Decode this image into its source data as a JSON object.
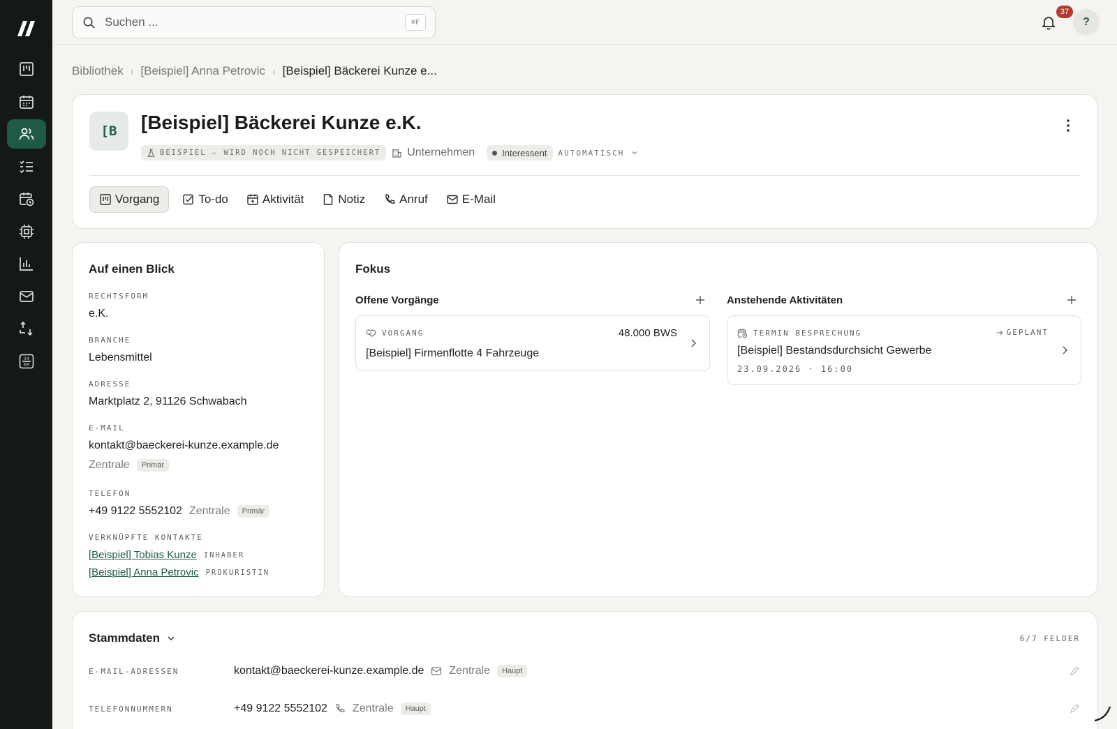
{
  "sidebar": {
    "items": [
      {
        "name": "dashboard"
      },
      {
        "name": "calendar"
      },
      {
        "name": "contacts",
        "active": true
      },
      {
        "name": "tasks"
      },
      {
        "name": "schedule"
      },
      {
        "name": "chip"
      },
      {
        "name": "reports"
      },
      {
        "name": "mail"
      },
      {
        "name": "import-export"
      },
      {
        "name": "tax",
        "label_top": "34",
        "label_bottom": "ER"
      }
    ]
  },
  "topbar": {
    "search_placeholder": "Suchen ...",
    "search_shortcut": "⌘F",
    "notification_count": "37",
    "help_label": "?"
  },
  "breadcrumb": {
    "items": [
      "Bibliothek",
      "[Beispiel] Anna Petrovic",
      "[Beispiel] Bäckerei Kunze e..."
    ]
  },
  "header": {
    "avatar": "[B",
    "title": "[Beispiel] Bäckerei Kunze e.K.",
    "example_badge": "BEISPIEL – WIRD NOCH NICHT GESPEICHERT",
    "type": "Unternehmen",
    "status": "Interessent",
    "status_mode": "AUTOMATISCH",
    "actions": [
      "Vorgang",
      "To-do",
      "Aktivität",
      "Notiz",
      "Anruf",
      "E-Mail"
    ]
  },
  "glance": {
    "title": "Auf einen Blick",
    "rechtsform_label": "RECHTSFORM",
    "rechtsform": "e.K.",
    "branche_label": "BRANCHE",
    "branche": "Lebensmittel",
    "adresse_label": "ADRESSE",
    "adresse": "Marktplatz 2, 91126 Schwabach",
    "email_label": "E-MAIL",
    "email": "kontakt@baeckerei-kunze.example.de",
    "email_type": "Zentrale",
    "email_badge": "Primär",
    "telefon_label": "TELEFON",
    "telefon": "+49 9122 5552102",
    "telefon_type": "Zentrale",
    "telefon_badge": "Primär",
    "contacts_label": "VERKNÜPFTE KONTAKTE",
    "contacts": [
      {
        "name": "[Beispiel] Tobias Kunze",
        "role": "INHABER"
      },
      {
        "name": "[Beispiel] Anna Petrovic",
        "role": "PROKURISTIN"
      }
    ]
  },
  "focus": {
    "title": "Fokus",
    "open_deals_title": "Offene Vorgänge",
    "deal": {
      "kicker": "VORGANG",
      "amount": "48.000 BWS",
      "title": "[Beispiel] Firmenflotte 4 Fahrzeuge"
    },
    "activities_title": "Anstehende Aktivitäten",
    "activity": {
      "kicker": "TERMIN BESPRECHUNG",
      "status": "GEPLANT",
      "title": "[Beispiel] Bestandsdurchsicht Gewerbe",
      "datetime": "23.09.2026 · 16:00"
    }
  },
  "stammdaten": {
    "title": "Stammdaten",
    "count": "6/7 FELDER",
    "rows": [
      {
        "label": "E-MAIL-ADRESSEN",
        "value": "kontakt@baeckerei-kunze.example.de",
        "type": "Zentrale",
        "badge": "Haupt"
      },
      {
        "label": "TELEFONNUMMERN",
        "value": "+49 9122 5552102",
        "type": "Zentrale",
        "badge": "Haupt"
      }
    ]
  },
  "colors": {
    "accent": "#1f5b44",
    "sidebar": "#141918",
    "badge": "#b53a2b"
  }
}
